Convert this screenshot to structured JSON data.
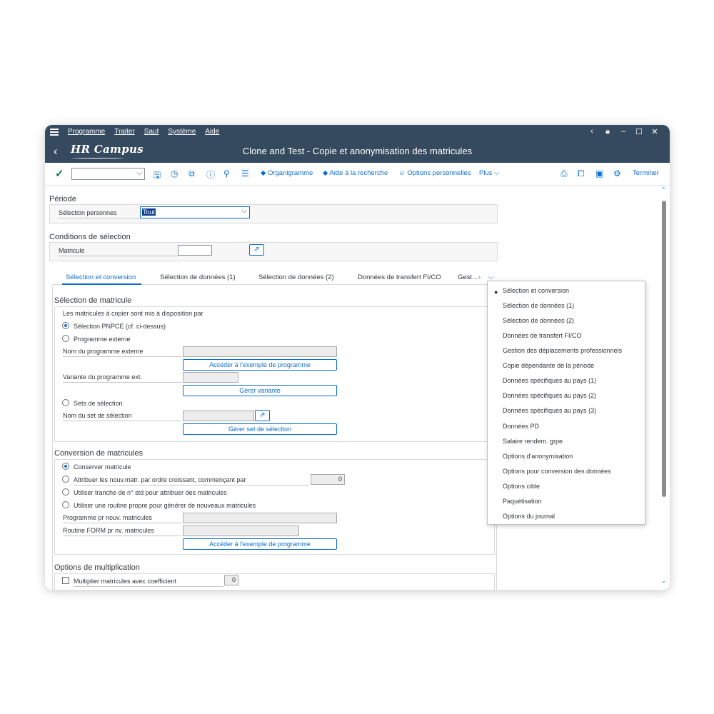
{
  "menubar": {
    "items": [
      "Programme",
      "Traiter",
      "Saut",
      "Système",
      "Aide"
    ]
  },
  "shellbar": {
    "logo": "HR Campus",
    "title": "Clone and Test - Copie et anonymisation des matricules"
  },
  "toolbar": {
    "organigramme": "Organigramme",
    "aide_recherche": "Aide à la recherche",
    "options_personnelles": "Options personnelles",
    "plus": "Plus",
    "terminer": "Terminer"
  },
  "periode": {
    "title": "Période",
    "selection_label": "Sélection personnes",
    "selection_value": "Tout"
  },
  "conditions": {
    "title": "Conditions de sélection",
    "matricule_label": "Matricule"
  },
  "tabs": [
    "Sélection et conversion",
    "Sélection de données (1)",
    "Sélection de données (2)",
    "Données de transfert FI/CO",
    "Gest..."
  ],
  "selection_matricule": {
    "title": "Sélection de matricule",
    "intro": "Les matricules à copier sont mis à disposition par",
    "opt_pnpce": "Sélection PNPCE (cf. ci-dessus)",
    "opt_externe": "Programme externe",
    "nom_prog_ext": "Nom du programme externe",
    "btn_acceder": "Accéder à l'exemple de programme",
    "variante": "Variante du programme ext.",
    "btn_gerer_variante": "Gérer variante",
    "opt_sets": "Sets de sélection",
    "nom_set": "Nom du set de sélection",
    "btn_gerer_set": "Gérer set de sélection"
  },
  "conversion": {
    "title": "Conversion de matricules",
    "opt_conserver": "Conserver matricule",
    "opt_attribuer": "Attribuer les nouv.matr. par ordre croissant, commençant par",
    "start_value": "0",
    "opt_tranche": "Utiliser tranche de n° std pour attribuer des matricules",
    "opt_routine": "Utiliser une routine propre pour générer de nouveaux matricules",
    "prog_nouv": "Programme pr nouv. matricules",
    "routine_form": "Routine FORM pr nv. matricules",
    "btn_acceder": "Accéder à l'exemple de programme"
  },
  "multiplication": {
    "title": "Options de multiplication",
    "checkbox_label": "Multiplier matricules avec coefficient",
    "coefficient": "0"
  },
  "dropdown": {
    "items": [
      "Sélection et conversion",
      "Sélection de données (1)",
      "Sélection de données (2)",
      "Données de transfert FI/CO",
      "Gestion des déplacements professionnels",
      "Copie dépendante de la période",
      "Données spécifiques au pays (1)",
      "Données spécifiques au pays (2)",
      "Données spécifiques au pays (3)",
      "Données PD",
      "Salaire rendem. grpe",
      "Options d'anonymisation",
      "Options pour conversion des données",
      "Options cible",
      "Paquétisation",
      "Options du journal"
    ]
  },
  "colors": {
    "shell": "#354a5f",
    "accent": "#0a6ed1",
    "check": "#107e3e"
  }
}
